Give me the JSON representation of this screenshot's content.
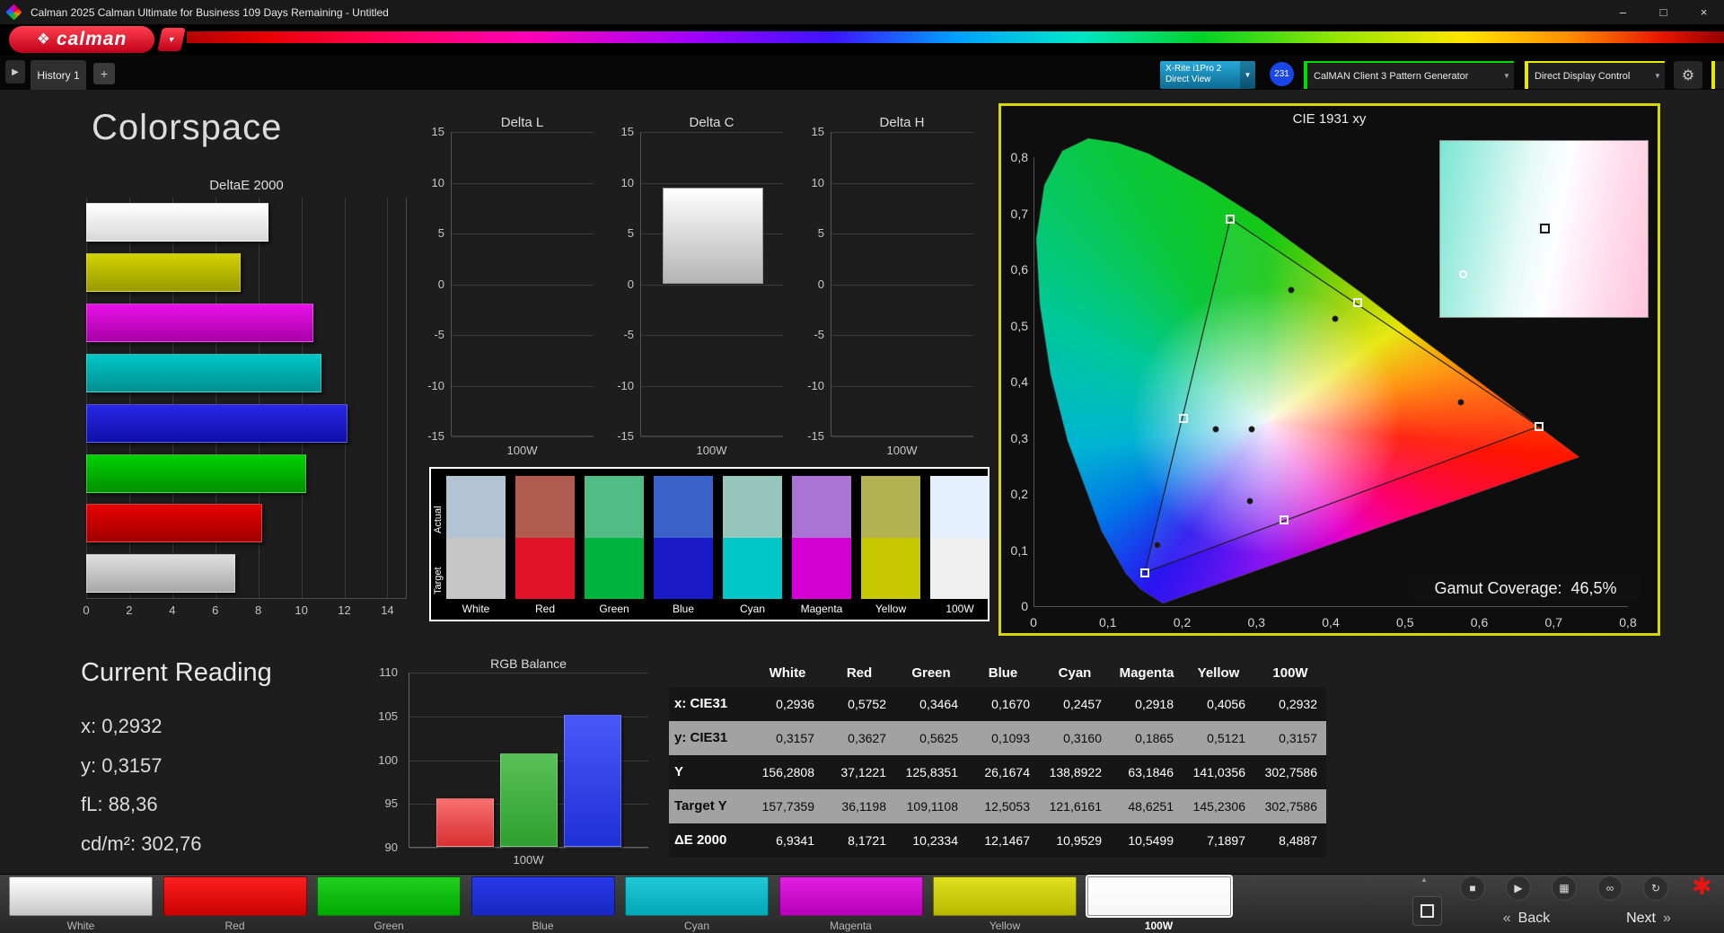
{
  "window": {
    "title": "Calman 2025 Calman Ultimate for Business 109 Days Remaining  - Untitled",
    "controls": {
      "minimize": "–",
      "maximize": "□",
      "close": "×"
    }
  },
  "logo": {
    "brand": "calman",
    "icon": "❖",
    "caret": "▼"
  },
  "tab_bar": {
    "nav_arrow": "▶",
    "history_tab": "History 1",
    "add_tab": "+"
  },
  "toolbar": {
    "meter_line1": "X-Rite i1Pro 2",
    "meter_line2": "Direct View",
    "meter_badge": "231",
    "pattern_source": "CalMAN Client 3 Pattern Generator",
    "display_control": "Direct Display Control",
    "caret": "▼",
    "gear": "⚙"
  },
  "page": {
    "title": "Colorspace"
  },
  "current_reading": {
    "title": "Current Reading",
    "lines": [
      "x: 0,2932",
      "y: 0,3157",
      "fL: 88,36",
      "cd/m²: 302,76"
    ]
  },
  "chart_data": [
    {
      "id": "deltae",
      "type": "bar",
      "orientation": "horizontal",
      "title": "DeltaE 2000",
      "categories": [
        "100W",
        "Yellow",
        "Magenta",
        "Cyan",
        "Blue",
        "Green",
        "Red",
        "White"
      ],
      "values": [
        8.4887,
        7.1897,
        10.5499,
        10.9529,
        12.1467,
        10.2334,
        8.1721,
        6.9341
      ],
      "bar_colors": [
        [
          "#ffffff",
          "#d8d8d8"
        ],
        [
          "#d2d200",
          "#9a9a00"
        ],
        [
          "#e812e8",
          "#a800a8"
        ],
        [
          "#00c8c8",
          "#008f8f"
        ],
        [
          "#2828e8",
          "#0f0fa8"
        ],
        [
          "#00d200",
          "#009000"
        ],
        [
          "#e80000",
          "#a00000"
        ],
        [
          "#e0e0e0",
          "#a8a8a8"
        ]
      ],
      "xlim": [
        0,
        14
      ],
      "xticks": [
        0,
        2,
        4,
        6,
        8,
        10,
        12,
        14
      ]
    },
    {
      "id": "delta_l",
      "type": "bar",
      "title": "Delta L",
      "categories": [
        "100W"
      ],
      "values": [
        null
      ],
      "ylim": [
        -15,
        15
      ],
      "yticks": [
        15,
        10,
        5,
        0,
        -5,
        -10,
        -15
      ],
      "xlabel": "100W"
    },
    {
      "id": "delta_c",
      "type": "bar",
      "title": "Delta C",
      "categories": [
        "100W"
      ],
      "values": [
        9.5
      ],
      "ylim": [
        -15,
        15
      ],
      "yticks": [
        15,
        10,
        5,
        0,
        -5,
        -10,
        -15
      ],
      "xlabel": "100W"
    },
    {
      "id": "delta_h",
      "type": "bar",
      "title": "Delta H",
      "categories": [
        "100W"
      ],
      "values": [
        null
      ],
      "ylim": [
        -15,
        15
      ],
      "yticks": [
        15,
        10,
        5,
        0,
        -5,
        -10,
        -15
      ],
      "xlabel": "100W"
    },
    {
      "id": "rgb_balance",
      "type": "bar",
      "title": "RGB Balance",
      "categories": [
        "Red",
        "Green",
        "Blue"
      ],
      "values": [
        95.5,
        100.7,
        105.1
      ],
      "bar_colors": [
        [
          "#f87070",
          "#d83030"
        ],
        [
          "#58c058",
          "#2f9f2f"
        ],
        [
          "#4858f8",
          "#2030d8"
        ]
      ],
      "ylim": [
        90,
        110
      ],
      "yticks": [
        110,
        105,
        100,
        95,
        90
      ],
      "xlabel": "100W"
    },
    {
      "id": "cie",
      "type": "scatter",
      "title": "CIE 1931 xy",
      "xlim": [
        0,
        0.8
      ],
      "ylim": [
        0,
        0.8
      ],
      "xticks": [
        {
          "label": "0",
          "v": 0
        },
        {
          "label": "0,1",
          "v": 0.1
        },
        {
          "label": "0,2",
          "v": 0.2
        },
        {
          "label": "0,3",
          "v": 0.3
        },
        {
          "label": "0,4",
          "v": 0.4
        },
        {
          "label": "0,5",
          "v": 0.5
        },
        {
          "label": "0,6",
          "v": 0.6
        },
        {
          "label": "0,7",
          "v": 0.7
        },
        {
          "label": "0,8",
          "v": 0.8
        }
      ],
      "yticks": [
        {
          "label": "0",
          "v": 0
        },
        {
          "label": "0,1",
          "v": 0.1
        },
        {
          "label": "0,2",
          "v": 0.2
        },
        {
          "label": "0,3",
          "v": 0.3
        },
        {
          "label": "0,4",
          "v": 0.4
        },
        {
          "label": "0,5",
          "v": 0.5
        },
        {
          "label": "0,6",
          "v": 0.6
        },
        {
          "label": "0,7",
          "v": 0.7
        },
        {
          "label": "0,8",
          "v": 0.8
        }
      ],
      "gamut_coverage_label": "Gamut Coverage:",
      "gamut_coverage_value": "46,5%",
      "target_gamut_triangle": [
        [
          0.265,
          0.69
        ],
        [
          0.68,
          0.32
        ],
        [
          0.15,
          0.06
        ]
      ],
      "target_points": [
        [
          0.313,
          0.334
        ],
        [
          0.202,
          0.334
        ],
        [
          0.265,
          0.69
        ],
        [
          0.436,
          0.541
        ],
        [
          0.68,
          0.32
        ],
        [
          0.337,
          0.154
        ],
        [
          0.15,
          0.06
        ]
      ],
      "measured_points": [
        [
          0.2936,
          0.3157
        ],
        [
          0.5752,
          0.3627
        ],
        [
          0.3464,
          0.5625
        ],
        [
          0.167,
          0.1093
        ],
        [
          0.2457,
          0.316
        ],
        [
          0.2918,
          0.1865
        ],
        [
          0.4056,
          0.5121
        ]
      ]
    }
  ],
  "swatch_panel": {
    "row_labels": [
      "Actual",
      "Target"
    ],
    "columns": [
      {
        "label": "White",
        "actual": "#b2c4d4",
        "target": "#c6c6c6"
      },
      {
        "label": "Red",
        "actual": "#b05a50",
        "target": "#e01228"
      },
      {
        "label": "Green",
        "actual": "#52bc86",
        "target": "#00b43e"
      },
      {
        "label": "Blue",
        "actual": "#3a62c8",
        "target": "#1a1ac8"
      },
      {
        "label": "Cyan",
        "actual": "#96c6bc",
        "target": "#00c8c8"
      },
      {
        "label": "Magenta",
        "actual": "#aa74d4",
        "target": "#d400d4"
      },
      {
        "label": "Yellow",
        "actual": "#b2b252",
        "target": "#c8c800"
      },
      {
        "label": "100W",
        "actual": "#e4f0fe",
        "target": "#f0f0f0"
      }
    ]
  },
  "table": {
    "columns": [
      "White",
      "Red",
      "Green",
      "Blue",
      "Cyan",
      "Magenta",
      "Yellow",
      "100W"
    ],
    "rows": [
      {
        "label": "x: CIE31",
        "values": [
          "0,2936",
          "0,5752",
          "0,3464",
          "0,1670",
          "0,2457",
          "0,2918",
          "0,4056",
          "0,2932"
        ]
      },
      {
        "label": "y: CIE31",
        "values": [
          "0,3157",
          "0,3627",
          "0,5625",
          "0,1093",
          "0,3160",
          "0,1865",
          "0,5121",
          "0,3157"
        ]
      },
      {
        "label": "Y",
        "values": [
          "156,2808",
          "37,1221",
          "125,8351",
          "26,1674",
          "138,8922",
          "63,1846",
          "141,0356",
          "302,7586"
        ]
      },
      {
        "label": "Target Y",
        "values": [
          "157,7359",
          "36,1198",
          "109,1108",
          "12,5053",
          "121,6161",
          "48,6251",
          "145,2306",
          "302,7586"
        ]
      },
      {
        "label": "ΔE 2000",
        "values": [
          "6,9341",
          "8,1721",
          "10,2334",
          "12,1467",
          "10,9529",
          "10,5499",
          "7,1897",
          "8,4887"
        ]
      }
    ]
  },
  "bottom_bar": {
    "patterns": [
      {
        "label": "White",
        "colors": [
          "#ffffff",
          "#c8c8c8"
        ],
        "selected": false
      },
      {
        "label": "Red",
        "colors": [
          "#ff2020",
          "#c80000"
        ],
        "selected": false
      },
      {
        "label": "Green",
        "colors": [
          "#20d020",
          "#00a800"
        ],
        "selected": false
      },
      {
        "label": "Blue",
        "colors": [
          "#2838e8",
          "#1828c0"
        ],
        "selected": false
      },
      {
        "label": "Cyan",
        "colors": [
          "#20c8d8",
          "#00a8b8"
        ],
        "selected": false
      },
      {
        "label": "Magenta",
        "colors": [
          "#e020e0",
          "#b800b8"
        ],
        "selected": false
      },
      {
        "label": "Yellow",
        "colors": [
          "#e0e020",
          "#b8b800"
        ],
        "selected": false
      },
      {
        "label": "100W",
        "colors": [
          "#ffffff",
          "#f6f6f6"
        ],
        "selected": true
      }
    ],
    "transport": [
      {
        "name": "stop",
        "glyph": "■"
      },
      {
        "name": "play",
        "glyph": "▶"
      },
      {
        "name": "save",
        "glyph": "▦"
      },
      {
        "name": "link",
        "glyph": "∞"
      },
      {
        "name": "refresh",
        "glyph": "↻"
      }
    ],
    "up_arrow": "▲",
    "asterisk": "✱",
    "back_chevron": "«",
    "back": "Back",
    "next": "Next",
    "next_chevron": "»"
  }
}
